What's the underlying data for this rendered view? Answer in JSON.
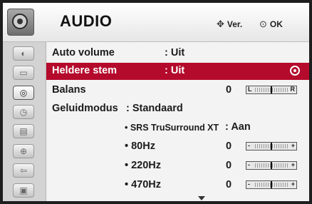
{
  "header": {
    "title": "AUDIO",
    "move_hint": "Ver.",
    "ok_hint": "OK"
  },
  "sidebar": {
    "items": [
      {
        "icon": "picture-icon"
      },
      {
        "icon": "screen-icon"
      },
      {
        "icon": "audio-icon",
        "active": true
      },
      {
        "icon": "clock-icon"
      },
      {
        "icon": "options-icon"
      },
      {
        "icon": "lock-icon"
      },
      {
        "icon": "input-icon"
      },
      {
        "icon": "usb-icon"
      }
    ]
  },
  "menu": {
    "auto_volume": {
      "label": "Auto volume",
      "value": ": Uit"
    },
    "clear_voice": {
      "label": "Heldere stem",
      "value": ": Uit"
    },
    "balance": {
      "label": "Balans",
      "value": "0",
      "left": "L",
      "right": "R"
    },
    "sound_mode": {
      "label": "Geluidmodus",
      "value": ": Standaard"
    },
    "srs": {
      "label": "• SRS TruSurround XT",
      "value": ": Aan"
    },
    "eq": [
      {
        "label": "• 80Hz",
        "value": "0",
        "minus": "-",
        "plus": "+"
      },
      {
        "label": "• 220Hz",
        "value": "0",
        "minus": "-",
        "plus": "+"
      },
      {
        "label": "• 470Hz",
        "value": "0",
        "minus": "-",
        "plus": "+"
      }
    ]
  },
  "colors": {
    "highlight": "#b40a2c"
  }
}
